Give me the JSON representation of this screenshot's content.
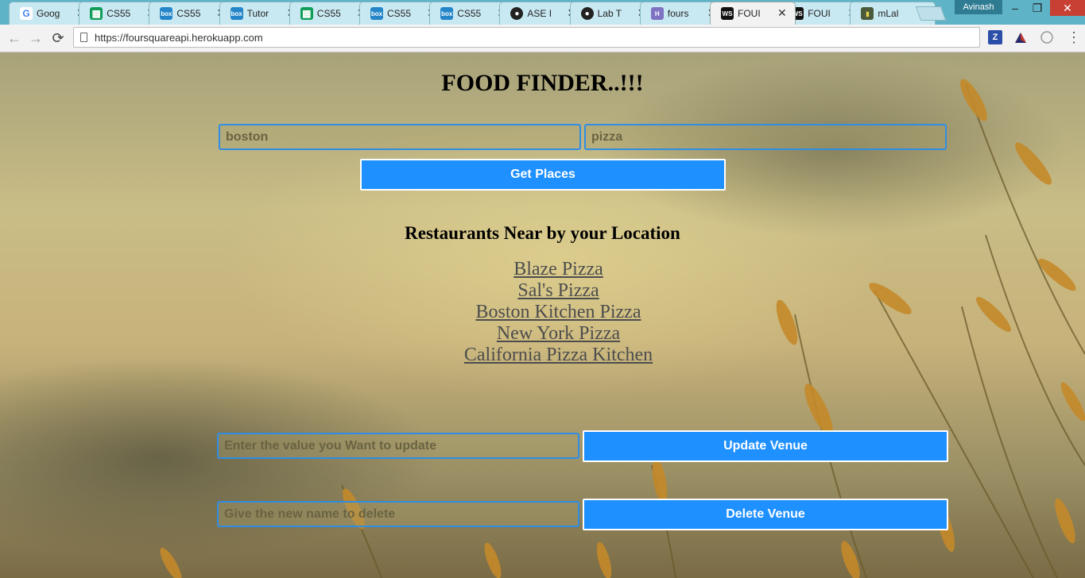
{
  "browser": {
    "tabs": [
      {
        "title": "Goog",
        "favicon": "google-icon",
        "favicon_color": "#4285f4"
      },
      {
        "title": "CS55",
        "favicon": "sheets-icon",
        "favicon_color": "#0f9d58"
      },
      {
        "title": "CS55",
        "favicon": "box-icon",
        "favicon_color": "#2486c8"
      },
      {
        "title": "Tutor",
        "favicon": "box-icon",
        "favicon_color": "#2486c8"
      },
      {
        "title": "CS55",
        "favicon": "sheets-icon",
        "favicon_color": "#0f9d58"
      },
      {
        "title": "CS55",
        "favicon": "box-icon",
        "favicon_color": "#2486c8"
      },
      {
        "title": "CS55",
        "favicon": "box-icon",
        "favicon_color": "#2486c8"
      },
      {
        "title": "ASE I",
        "favicon": "github-icon",
        "favicon_color": "#222222"
      },
      {
        "title": "Lab T",
        "favicon": "github-icon",
        "favicon_color": "#222222"
      },
      {
        "title": "fours",
        "favicon": "heroku-icon",
        "favicon_color": "#7f72c2"
      },
      {
        "title": "FOUI",
        "favicon": "webstorm-icon",
        "favicon_color": "#111111",
        "active": true
      },
      {
        "title": "FOUI",
        "favicon": "webstorm-icon",
        "favicon_color": "#111111"
      },
      {
        "title": "mLal",
        "favicon": "mlab-icon",
        "favicon_color": "#4a5a3a"
      }
    ],
    "favicon_text": {
      "box": "box",
      "ws": "WS",
      "h": "H"
    },
    "close_glyph": "✕",
    "profile_name": "Avinash",
    "url": "https://foursquareapi.herokuapp.com",
    "window_controls": {
      "minimize": "–",
      "maximize": "❐",
      "close": "✕"
    },
    "nav": {
      "back": "←",
      "forward": "→",
      "reload": "⟳"
    },
    "extensions": {
      "z_label": "Z",
      "menu": "⋮"
    }
  },
  "page": {
    "title": "FOOD FINDER..!!!",
    "search": {
      "location_value": "boston",
      "query_value": "pizza",
      "button_label": "Get Places"
    },
    "results_heading": "Restaurants Near by your Location",
    "places": [
      "Blaze Pizza",
      "Sal's Pizza",
      "Boston Kitchen Pizza",
      "New York Pizza",
      "California Pizza Kitchen"
    ],
    "update": {
      "placeholder": "Enter the value you Want to update",
      "button_label": "Update Venue"
    },
    "delete": {
      "placeholder": "Give the new name to delete",
      "button_label": "Delete Venue"
    },
    "colors": {
      "accent": "#1e90ff",
      "input_border": "#2f8de4",
      "link": "#4d4d4d"
    }
  }
}
